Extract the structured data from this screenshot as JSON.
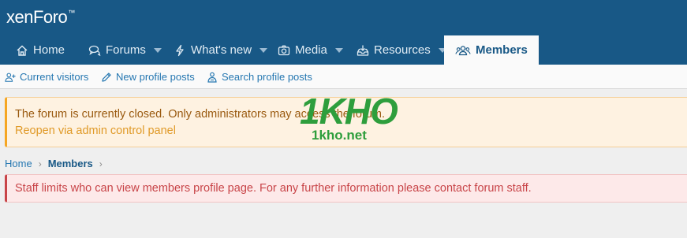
{
  "header": {
    "logo_text": "xenForo",
    "logo_mark": "™"
  },
  "nav": {
    "tabs": [
      {
        "label": "Home",
        "icon": "home-icon",
        "has_caret": false
      },
      {
        "label": "Forums",
        "icon": "comments-icon",
        "has_caret": true
      },
      {
        "label": "What's new",
        "icon": "bolt-icon",
        "has_caret": true
      },
      {
        "label": "Media",
        "icon": "camera-icon",
        "has_caret": true
      },
      {
        "label": "Resources",
        "icon": "inbox-download-icon",
        "has_caret": true
      },
      {
        "label": "Members",
        "icon": "users-icon",
        "has_caret": false,
        "active": true
      }
    ]
  },
  "subnav": {
    "items": [
      {
        "label": "Current visitors",
        "icon": "user-plus-icon"
      },
      {
        "label": "New profile posts",
        "icon": "pencil-icon"
      },
      {
        "label": "Search profile posts",
        "icon": "search-person-icon"
      }
    ]
  },
  "notice": {
    "message": "The forum is currently closed. Only administrators may access the forum.",
    "link": "Reopen via admin control panel"
  },
  "watermark": {
    "big": "1KHO",
    "small": "1kho.net"
  },
  "breadcrumb": {
    "home": "Home",
    "separator": "›",
    "current": "Members",
    "trailing": "›"
  },
  "alert": {
    "message": "Staff limits who can view members profile page. For any further information please contact forum staff."
  },
  "colors": {
    "header_bg": "#185886",
    "link": "#2577b1",
    "notice_bg": "#fef2e1",
    "alert_bg": "#fde9e9",
    "alert_text": "#c84448",
    "watermark": "#2e9e3c"
  }
}
